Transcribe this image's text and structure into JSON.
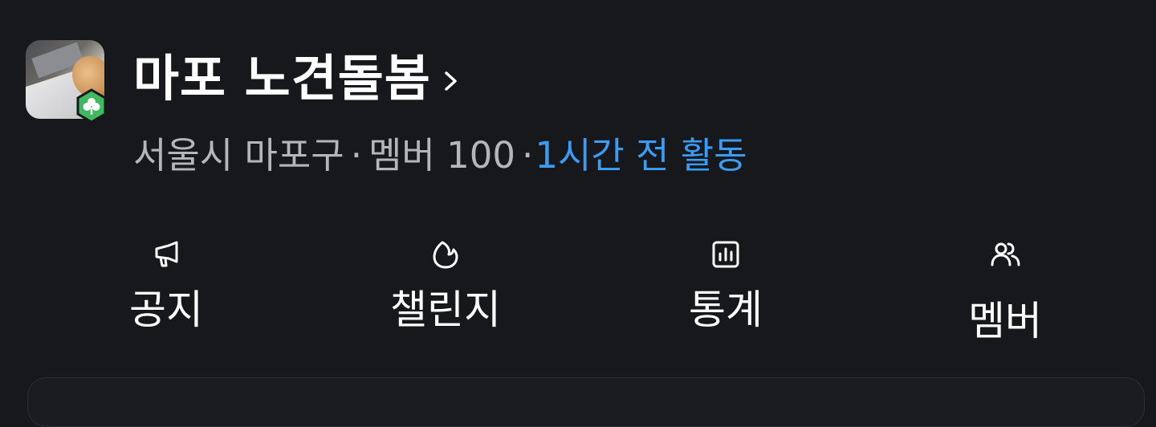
{
  "community": {
    "title": "마포 노견돌봄",
    "location": "서울시 마포구",
    "separator": "·",
    "members": "멤버 100",
    "activity": "1시간 전 활동"
  },
  "menu": {
    "items": [
      {
        "label": "공지",
        "icon": "megaphone-icon"
      },
      {
        "label": "챌린지",
        "icon": "flame-icon"
      },
      {
        "label": "통계",
        "icon": "chart-icon"
      },
      {
        "label": "멤버",
        "icon": "people-icon"
      }
    ]
  },
  "colors": {
    "background": "#17181c",
    "accent": "#3a9cf5",
    "muted": "#b5b6bb",
    "badge": "#3fb95f"
  }
}
